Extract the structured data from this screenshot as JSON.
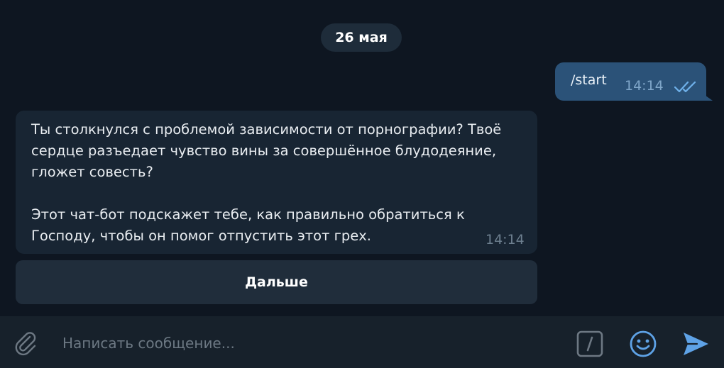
{
  "chat": {
    "date_label": "26 мая",
    "outgoing": {
      "text": "/start",
      "time": "14:14",
      "status_icon": "double-check-icon"
    },
    "incoming": {
      "text": "Ты столкнулся с проблемой зависимости от порнографии? Твоё сердце разъедает чувство вины за совершённое блудодеяние, гложет совесть?\n\nЭтот чат-бот подскажет тебе, как правильно обратиться к Господу, чтобы он помог отпустить этот грех.",
      "time": "14:14"
    },
    "keyboard_button": "Дальше"
  },
  "composer": {
    "placeholder": "Написать сообщение...",
    "icons": {
      "attach": "paperclip-icon",
      "commands": "bot-command-icon",
      "emoji": "emoji-icon",
      "send": "send-icon"
    }
  },
  "colors": {
    "background": "#0e1621",
    "outgoing_bubble": "#2b5278",
    "incoming_bubble": "#182533",
    "accent": "#5ea2e6"
  }
}
